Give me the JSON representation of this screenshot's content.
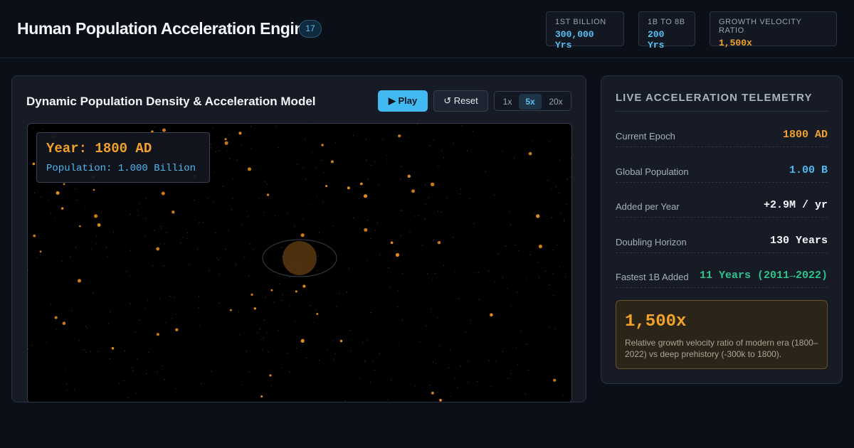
{
  "header": {
    "title": "Human Population Acceleration Engine",
    "badge": "17",
    "stats": [
      {
        "label": "1st Billion",
        "value": "300,000 Yrs",
        "color": "#58c0f3"
      },
      {
        "label": "1B to 8B",
        "value": "200 Yrs",
        "color": "#58c0f3"
      },
      {
        "label": "Growth Velocity Ratio",
        "value": "1,500x",
        "color": "#f0a22b"
      }
    ]
  },
  "simulation": {
    "title": "Dynamic Population Density & Acceleration Model",
    "play_label": "Play",
    "play_icon": "▶",
    "reset_label": "Reset",
    "reset_icon": "↺",
    "speeds": [
      "1x",
      "5x",
      "20x"
    ],
    "active_speed": "5x",
    "year_text": "Year: 1800 AD",
    "population_text": "Population: 1.000 Billion"
  },
  "telemetry": {
    "title": "Live Acceleration Telemetry",
    "rows": [
      {
        "label": "Current Epoch",
        "value": "1800 AD",
        "color": "#f0a22b"
      },
      {
        "label": "Global Population",
        "value": "1.00 B",
        "color": "#4fb8ee"
      },
      {
        "label": "Added per Year",
        "value": "+2.9M / yr",
        "color": "#f3f5f8"
      },
      {
        "label": "Doubling Horizon",
        "value": "130 Years",
        "color": "#f3f5f8"
      },
      {
        "label": "Fastest 1B Added",
        "value": "11 Years (2011→2022)",
        "color": "#2bc48a"
      }
    ],
    "ratio_value": "1,500x",
    "ratio_description": "Relative growth velocity ratio of modern era (1800–2022) vs deep prehistory (-300k to 1800)."
  },
  "colors": {
    "accent_blue": "#43b9f2",
    "accent_orange": "#f0a22b",
    "accent_green": "#2bc48a",
    "background": "#0b0f17"
  }
}
